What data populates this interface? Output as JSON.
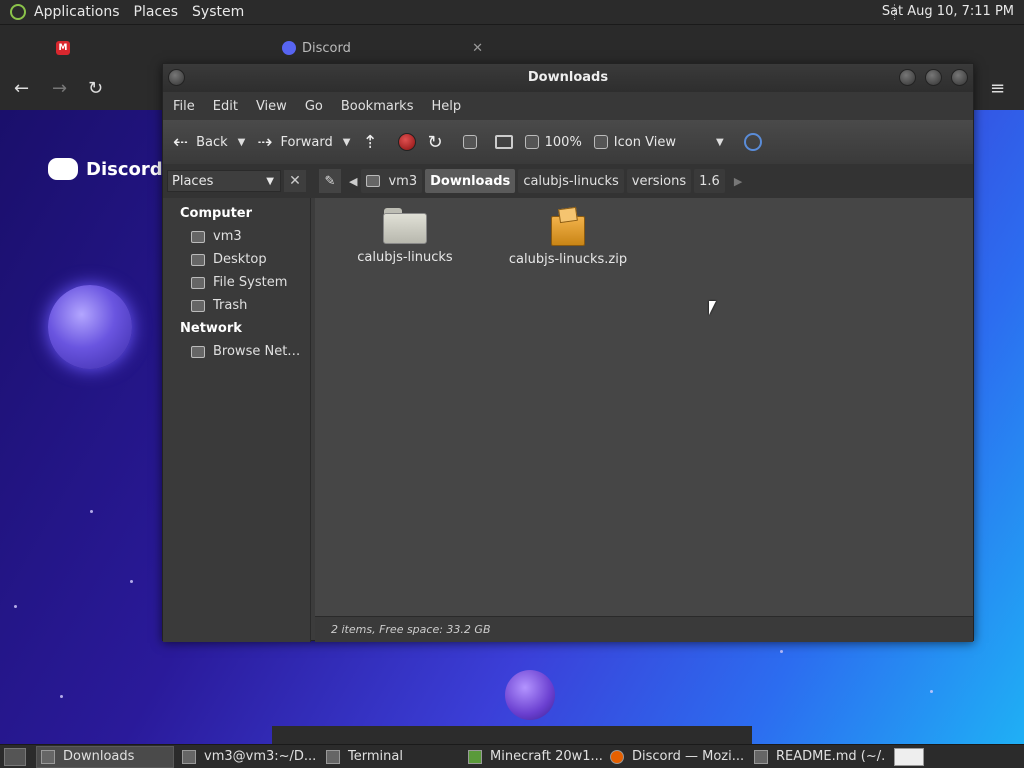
{
  "top_panel": {
    "menus": [
      "Applications",
      "Places",
      "System"
    ],
    "clock": "Sat Aug 10,  7:11 PM"
  },
  "browser": {
    "tabs": [
      {
        "icon": "M",
        "label": ""
      },
      {
        "label": "Discord"
      }
    ],
    "brand_text": "Discord"
  },
  "file_manager": {
    "title": "Downloads",
    "menu": [
      "File",
      "Edit",
      "View",
      "Go",
      "Bookmarks",
      "Help"
    ],
    "toolbar": {
      "back": "Back",
      "forward": "Forward",
      "zoom": "100%",
      "view_mode": "Icon View"
    },
    "places_select": "Places",
    "breadcrumbs": [
      "vm3",
      "Downloads",
      "calubjs-linucks",
      "versions",
      "1.6"
    ],
    "active_crumb": "Downloads",
    "sidebar": {
      "computer_header": "Computer",
      "computer_items": [
        "vm3",
        "Desktop",
        "File System",
        "Trash"
      ],
      "network_header": "Network",
      "network_items": [
        "Browse Net…"
      ]
    },
    "files": [
      {
        "name": "calubjs-linucks",
        "type": "folder"
      },
      {
        "name": "calubjs-linucks.zip",
        "type": "zip"
      }
    ],
    "status": "2 items, Free space: 33.2 GB"
  },
  "taskbar": {
    "tasks": [
      {
        "label": "Downloads",
        "active": true
      },
      {
        "label": "vm3@vm3:~/D...",
        "active": false
      },
      {
        "label": "Terminal",
        "active": false
      },
      {
        "label": "Minecraft 20w1...",
        "active": false
      },
      {
        "label": "Discord — Mozi...",
        "active": false
      },
      {
        "label": "README.md (~/...",
        "active": false
      }
    ]
  }
}
